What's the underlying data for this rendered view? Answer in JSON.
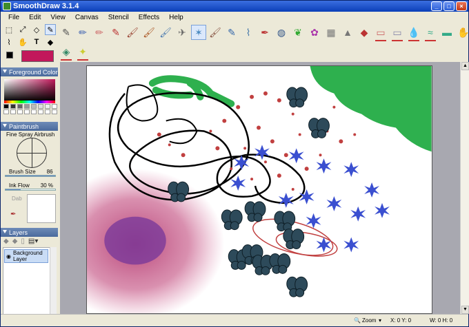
{
  "window": {
    "title": "SmoothDraw 3.1.4"
  },
  "menu": [
    "File",
    "Edit",
    "View",
    "Canvas",
    "Stencil",
    "Effects",
    "Help"
  ],
  "toolbar": {
    "row1": [
      "pen-icon",
      "pencil-icon",
      "crayon-icon",
      "marker-icon",
      "brush-icon",
      "oil-brush-icon",
      "watercolor-icon",
      "airbrush-icon",
      "spray-icon",
      "bristle-icon",
      "pump-icon",
      "pipe-icon",
      "feather-icon",
      "blur-icon",
      "grass-icon",
      "flower-icon",
      "fence-icon",
      "stamp-icon",
      "stamp2-icon",
      "eraser-icon",
      "soft-eraser-icon",
      "drop-icon",
      "smudge-icon",
      "roller-icon",
      "hand-icon"
    ],
    "row2": [
      "image-hose-icon",
      "sparkle-icon"
    ],
    "selected_index": 8
  },
  "foreground": {
    "color": "#c2185b",
    "secondary": "#000000"
  },
  "panels": {
    "foreground_color": "Foreground Color",
    "paintbrush": "Paintbrush",
    "layers": "Layers"
  },
  "brush": {
    "name": "Fine Spray Airbrush",
    "size_label": "Brush Size",
    "size_value": "86",
    "flow_label": "Ink Flow",
    "flow_value": "30 %",
    "flow_fraction": 0.3,
    "dab_label": "Dab"
  },
  "layers": [
    {
      "name": "Background Layer"
    }
  ],
  "palette": [
    "#000000",
    "#333333",
    "#666666",
    "#999999",
    "#bbbbbb",
    "#dddddd",
    "#eeeeee",
    "#ffffff",
    "#ffffff",
    "#ffffff",
    "#ffffff",
    "#ffffff",
    "#ffffff",
    "#ffffff",
    "#ffffff",
    "#ffffff"
  ],
  "status": {
    "zoom_label": "Zoom",
    "xy": "X: 0 Y: 0",
    "wh": "W: 0 H: 0"
  }
}
